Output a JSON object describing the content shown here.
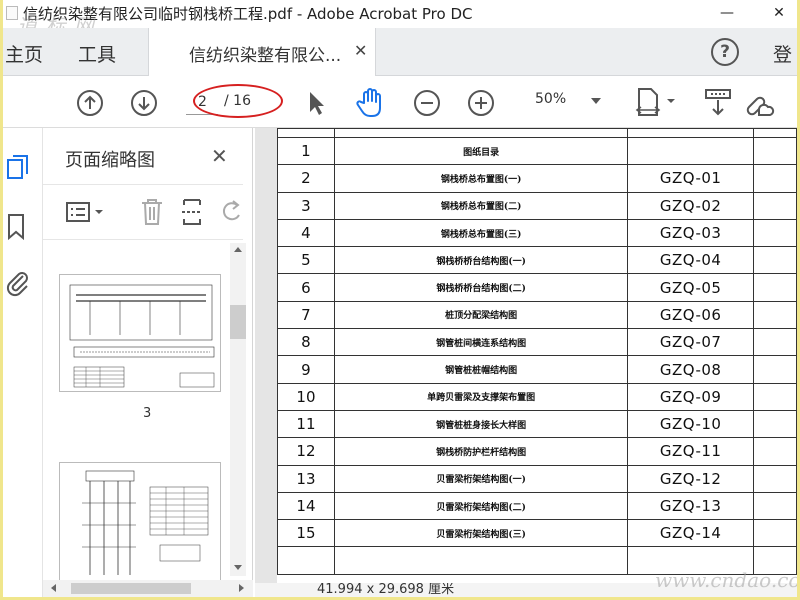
{
  "window": {
    "title": "信纺织染整有限公司临时钢栈桥工程.pdf - Adobe Acrobat Pro DC",
    "watermark_top": "道 标 网",
    "minimize": "—",
    "close": "✕"
  },
  "tabs": {
    "home": "主页",
    "tools": "工具",
    "doc": "信纺织染整有限公...",
    "doc_close": "✕",
    "login": "登"
  },
  "toolbar": {
    "page_current": "2",
    "page_total": "/ 16",
    "zoom": "50%"
  },
  "panel": {
    "title": "页面缩略图",
    "close": "✕",
    "thumb_label": "3"
  },
  "table": {
    "rows": [
      {
        "no": "1",
        "name": "图纸目录",
        "code": ""
      },
      {
        "no": "2",
        "name": "钢栈桥总布置图(一)",
        "code": "GZQ-01"
      },
      {
        "no": "3",
        "name": "钢栈桥总布置图(二)",
        "code": "GZQ-02"
      },
      {
        "no": "4",
        "name": "钢栈桥总布置图(三)",
        "code": "GZQ-03"
      },
      {
        "no": "5",
        "name": "钢栈桥桥台结构图(一)",
        "code": "GZQ-04"
      },
      {
        "no": "6",
        "name": "钢栈桥桥台结构图(二)",
        "code": "GZQ-05"
      },
      {
        "no": "7",
        "name": "桩顶分配梁结构图",
        "code": "GZQ-06"
      },
      {
        "no": "8",
        "name": "钢管桩间横连系结构图",
        "code": "GZQ-07"
      },
      {
        "no": "9",
        "name": "钢管桩桩帽结构图",
        "code": "GZQ-08"
      },
      {
        "no": "10",
        "name": "单跨贝雷梁及支撑架布置图",
        "code": "GZQ-09"
      },
      {
        "no": "11",
        "name": "钢管桩桩身接长大样图",
        "code": "GZQ-10"
      },
      {
        "no": "12",
        "name": "钢栈桥防护栏杆结构图",
        "code": "GZQ-11"
      },
      {
        "no": "13",
        "name": "贝雷梁桁架结构图(一)",
        "code": "GZQ-12"
      },
      {
        "no": "14",
        "name": "贝雷梁桁架结构图(二)",
        "code": "GZQ-13"
      },
      {
        "no": "15",
        "name": "贝雷梁桁架结构图(三)",
        "code": "GZQ-14"
      }
    ]
  },
  "status": {
    "page_size": "41.994 x 29.698 厘米"
  },
  "watermark_bottom": "www.cndao.com"
}
